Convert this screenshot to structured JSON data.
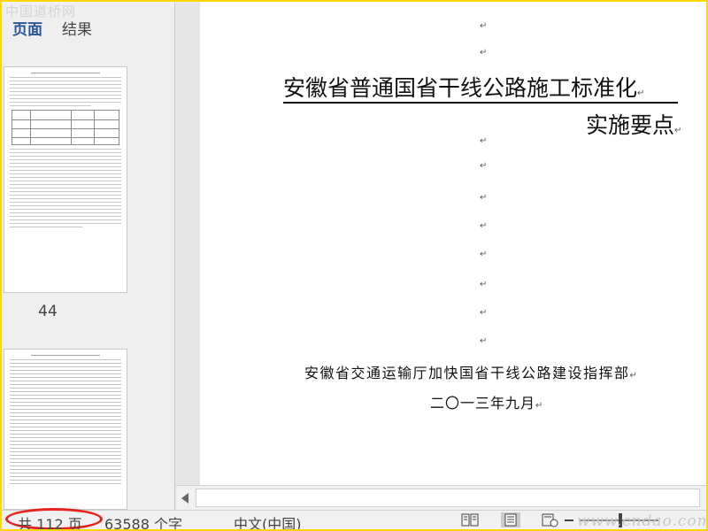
{
  "watermark_top": "中国道桥网",
  "nav": {
    "tabs": [
      {
        "label": "页面"
      },
      {
        "label": "结果"
      }
    ],
    "page_numbers": [
      "44"
    ]
  },
  "document": {
    "title_line1": "安徽省普通国省干线公路施工标准化",
    "title_line2": "实施要点",
    "organization": "安徽省交通运输厅加快国省干线公路建设指挥部",
    "date": "二〇一三年九月",
    "paragraph_mark": "↵"
  },
  "status": {
    "page_count": "共 112 页",
    "word_count": "63588 个字",
    "language": "中文(中国)"
  },
  "watermark_bottom": "www.cndao.com",
  "colors": {
    "border_highlight": "#ffd800",
    "annotation_circle": "#e8231f",
    "active_tab": "#2b579a"
  }
}
